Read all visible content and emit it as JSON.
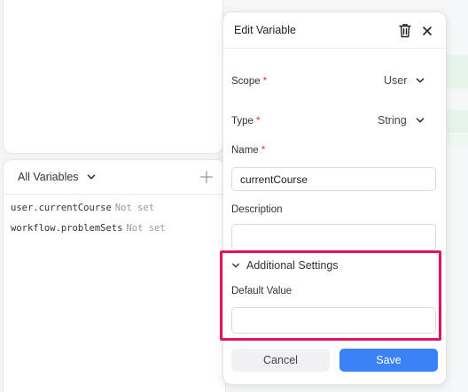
{
  "variables_panel": {
    "title": "All Variables",
    "items": [
      {
        "name": "user.currentCourse",
        "value": "Not set"
      },
      {
        "name": "workflow.problemSets",
        "value": "Not set"
      }
    ]
  },
  "dialog": {
    "title": "Edit Variable",
    "scope": {
      "label": "Scope",
      "required_mark": "*",
      "value": "User"
    },
    "type": {
      "label": "Type",
      "required_mark": "*",
      "value": "String"
    },
    "name": {
      "label": "Name",
      "required_mark": "*",
      "value": "currentCourse"
    },
    "description": {
      "label": "Description",
      "value": ""
    },
    "additional_settings": {
      "label": "Additional Settings",
      "default_value_label": "Default Value",
      "default_value": ""
    },
    "cancel_label": "Cancel",
    "save_label": "Save"
  },
  "colors": {
    "primary": "#3b82f6",
    "highlight": "#e0155f",
    "required": "#e0342c"
  },
  "icons": {
    "panel_dropdown": "chevron-down-icon",
    "add": "plus-icon",
    "delete": "trash-icon",
    "close": "close-icon",
    "select_dropdown": "chevron-down-icon",
    "section_toggle": "chevron-down-icon"
  }
}
